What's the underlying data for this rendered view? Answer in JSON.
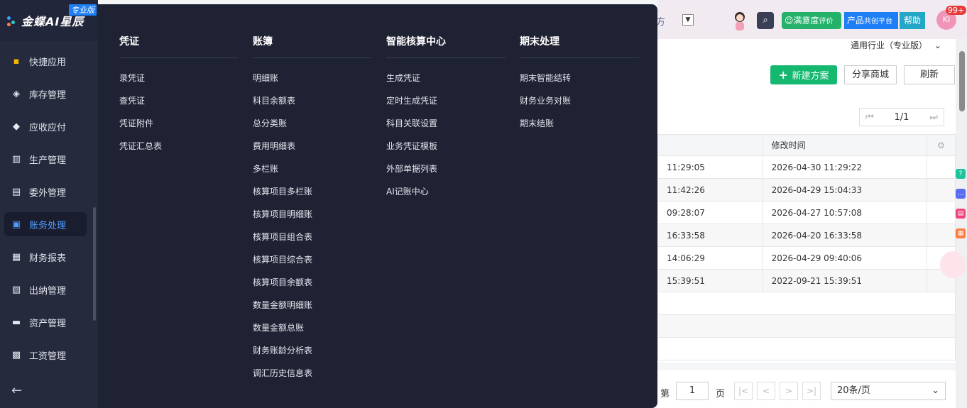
{
  "logo": {
    "text": "金蝶AI星辰",
    "badge": "专业版"
  },
  "sidebar": {
    "items": [
      {
        "label": "快捷应用",
        "icon": "apps-icon"
      },
      {
        "label": "库存管理",
        "icon": "box-icon"
      },
      {
        "label": "应收应付",
        "icon": "receivable-icon"
      },
      {
        "label": "生产管理",
        "icon": "factory-icon"
      },
      {
        "label": "委外管理",
        "icon": "outsource-icon"
      },
      {
        "label": "账务处理",
        "icon": "ledger-icon"
      },
      {
        "label": "财务报表",
        "icon": "report-icon"
      },
      {
        "label": "出纳管理",
        "icon": "cashier-icon"
      },
      {
        "label": "资产管理",
        "icon": "asset-icon"
      },
      {
        "label": "工资管理",
        "icon": "salary-icon"
      }
    ],
    "active": "账务处理",
    "collapse_icon": "←"
  },
  "menu": {
    "columns": [
      {
        "title": "凭证",
        "items": [
          "录凭证",
          "查凭证",
          "凭证附件",
          "凭证汇总表"
        ]
      },
      {
        "title": "账簿",
        "items": [
          "明细账",
          "科目余额表",
          "总分类账",
          "费用明细表",
          "多栏账",
          "核算项目多栏账",
          "核算项目明细账",
          "核算项目组合表",
          "核算项目综合表",
          "核算项目余额表",
          "数量金额明细账",
          "数量金额总账",
          "财务账龄分析表",
          "调汇历史信息表"
        ]
      },
      {
        "title": "智能核算中心",
        "items": [
          "生成凭证",
          "定时生成凭证",
          "科目关联设置",
          "业务凭证模板",
          "外部单据列表",
          "AI记账中心"
        ]
      },
      {
        "title": "期末处理",
        "items": [
          "期末智能结转",
          "财务业务对账",
          "期末结账"
        ]
      }
    ]
  },
  "topbar": {
    "cut_text": "方",
    "dropdown": "▼",
    "search_icon": "⌕",
    "satisfaction": "满意度",
    "satisfaction_sub": "评价",
    "product": "产品",
    "product_sub": "共创平台",
    "help": "帮助",
    "user_initials": "KI",
    "badge": "99+"
  },
  "toolbar": {
    "industry": "通用行业（专业版）",
    "new_plan": "新建方案",
    "share": "分享商城",
    "refresh": "刷新"
  },
  "pager_top": {
    "first": "K",
    "prev": "<",
    "page": "1/1",
    "next": ">",
    "last": "K"
  },
  "table": {
    "headers": [
      "",
      "修改时间"
    ],
    "rows": [
      [
        "11:29:05",
        "2026-04-30 11:29:22"
      ],
      [
        "11:42:26",
        "2026-04-29 15:04:33"
      ],
      [
        "09:28:07",
        "2026-04-27 10:57:08"
      ],
      [
        "16:33:58",
        "2026-04-20 16:33:58"
      ],
      [
        "14:06:29",
        "2026-04-29 09:40:06"
      ],
      [
        "15:39:51",
        "2022-09-21 15:39:51"
      ]
    ]
  },
  "pager_bottom": {
    "prefix": "第",
    "page": "1",
    "suffix": "页",
    "size": "20条/页"
  },
  "colors": {
    "sidebar": "#262a3d",
    "panel": "#1f2233",
    "active": "#4f9bff",
    "green": "#14b86e",
    "blue": "#1e7ef5"
  }
}
